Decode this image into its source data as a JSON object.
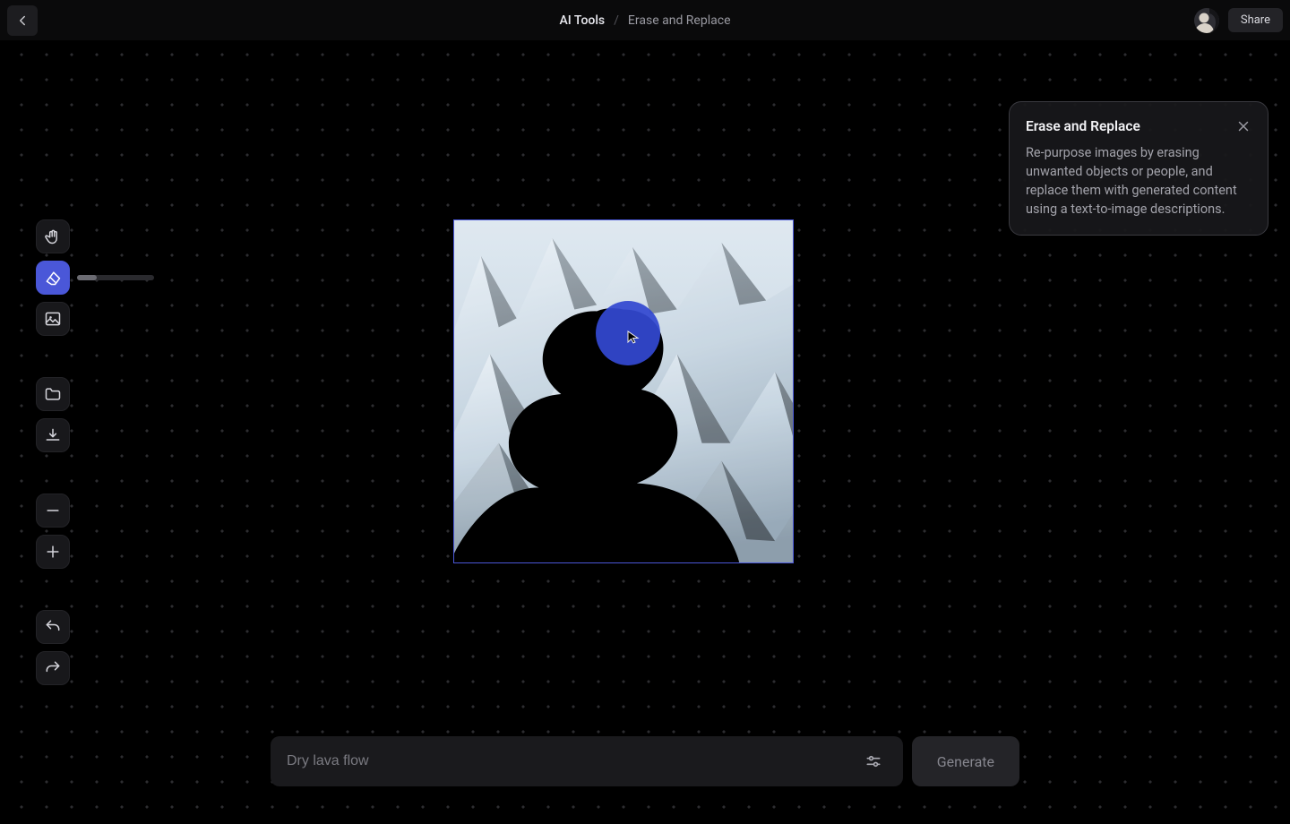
{
  "header": {
    "breadcrumb_main": "AI Tools",
    "breadcrumb_sep": "/",
    "breadcrumb_sub": "Erase and Replace",
    "share_label": "Share"
  },
  "tools": {
    "hand": "hand-tool",
    "eraser": "eraser-tool",
    "eraser_slider_pct": 26,
    "image": "image-tool",
    "folder": "folder-tool",
    "download": "download-tool",
    "zoom_out": "zoom-out",
    "zoom_in": "zoom-in",
    "undo": "undo",
    "redo": "redo"
  },
  "info": {
    "title": "Erase and Replace",
    "description": "Re-purpose images by erasing unwanted objects or people, and replace them with generated content using a text-to-image descriptions."
  },
  "prompt": {
    "placeholder": "Dry lava flow",
    "generate_label": "Generate"
  },
  "colors": {
    "accent": "#4a57d8"
  }
}
